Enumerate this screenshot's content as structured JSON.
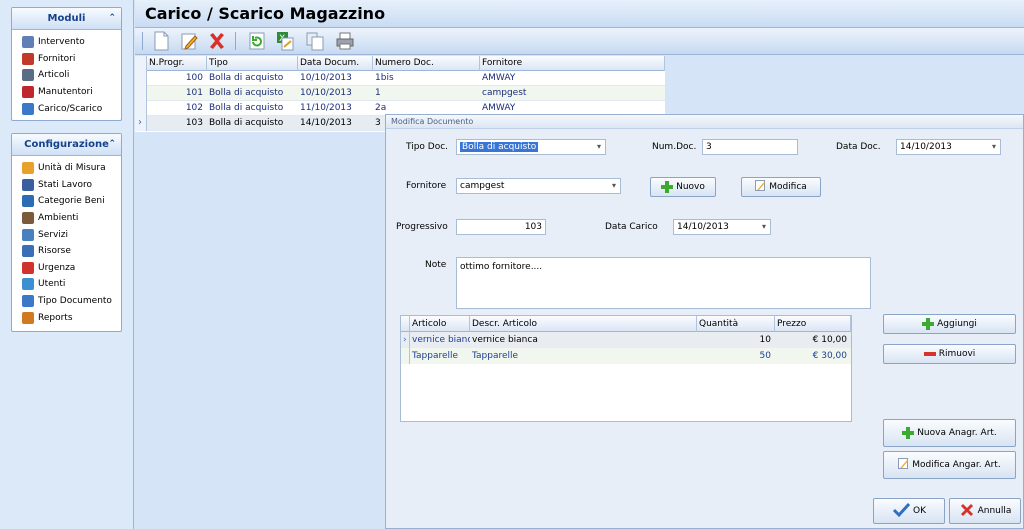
{
  "sidebar": {
    "moduli_title": "Moduli",
    "moduli_items": [
      {
        "label": "Intervento",
        "icon": "wrench-screwdriver-icon",
        "color": "#5f7fb5"
      },
      {
        "label": "Fornitori",
        "icon": "address-book-icon",
        "color": "#c0392b"
      },
      {
        "label": "Articoli",
        "icon": "tools-icon",
        "color": "#5b6c84"
      },
      {
        "label": "Manutentori",
        "icon": "toolbox-icon",
        "color": "#c0262d"
      },
      {
        "label": "Carico/Scarico",
        "icon": "truck-icon",
        "color": "#3c78c8"
      }
    ],
    "config_title": "Configurazione",
    "config_items": [
      {
        "label": "Unità di Misura",
        "icon": "ruler-icon",
        "color": "#e8a12a"
      },
      {
        "label": "Stati Lavoro",
        "icon": "worker-icon",
        "color": "#3a5fa0"
      },
      {
        "label": "Categorie Beni",
        "icon": "categories-icon",
        "color": "#2b6cb5"
      },
      {
        "label": "Ambienti",
        "icon": "rooms-icon",
        "color": "#7a5a3a"
      },
      {
        "label": "Servizi",
        "icon": "services-icon",
        "color": "#4a7fc0"
      },
      {
        "label": "Risorse",
        "icon": "users-icon",
        "color": "#3a6fb5"
      },
      {
        "label": "Urgenza",
        "icon": "alarm-clock-icon",
        "color": "#d0322d"
      },
      {
        "label": "Utenti",
        "icon": "user-icon",
        "color": "#3c8fd0"
      },
      {
        "label": "Tipo Documento",
        "icon": "document-icon",
        "color": "#3c78c8"
      },
      {
        "label": "Reports",
        "icon": "chart-icon",
        "color": "#d07a20"
      }
    ]
  },
  "header": {
    "title": "Carico / Scarico Magazzino"
  },
  "grid": {
    "columns": [
      "N.Progr.",
      "Tipo",
      "Data Docum.",
      "Numero Doc.",
      "Fornitore"
    ],
    "rows": [
      {
        "progr": "100",
        "tipo": "Bolla di acquisto",
        "data": "10/10/2013",
        "numero": "1bis",
        "fornitore": "AMWAY"
      },
      {
        "progr": "101",
        "tipo": "Bolla di acquisto",
        "data": "10/10/2013",
        "numero": "1",
        "fornitore": "campgest"
      },
      {
        "progr": "102",
        "tipo": "Bolla di acquisto",
        "data": "11/10/2013",
        "numero": "2a",
        "fornitore": "AMWAY"
      },
      {
        "progr": "103",
        "tipo": "Bolla di acquisto",
        "data": "14/10/2013",
        "numero": "3",
        "fornitore": ""
      }
    ]
  },
  "dialog": {
    "title": "Modifica Documento",
    "tipo_doc_label": "Tipo Doc.",
    "tipo_doc_value": "Bolla di acquisto",
    "num_doc_label": "Num.Doc.",
    "num_doc_value": "3",
    "data_doc_label": "Data Doc.",
    "data_doc_value": "14/10/2013",
    "fornitore_label": "Fornitore",
    "fornitore_value": "campgest",
    "nuovo_label": "Nuovo",
    "modifica_label": "Modifica",
    "progressivo_label": "Progressivo",
    "progressivo_value": "103",
    "data_carico_label": "Data Carico",
    "data_carico_value": "14/10/2013",
    "note_label": "Note",
    "note_value": "ottimo fornitore....",
    "detail_columns": [
      "Articolo",
      "Descr. Articolo",
      "Quantità",
      "Prezzo"
    ],
    "detail_rows": [
      {
        "articolo": "vernice bianc",
        "descr": "vernice bianca",
        "quantita": "10",
        "prezzo": "€ 10,00"
      },
      {
        "articolo": "Tapparelle",
        "descr": "Tapparelle",
        "quantita": "50",
        "prezzo": "€ 30,00"
      }
    ],
    "aggiungi_label": "Aggiungi",
    "rimuovi_label": "Rimuovi",
    "nuova_anagr_label": "Nuova Anagr. Art.",
    "modifica_anagr_label": "Modifica Angar. Art.",
    "ok_label": "OK",
    "annulla_label": "Annulla"
  }
}
